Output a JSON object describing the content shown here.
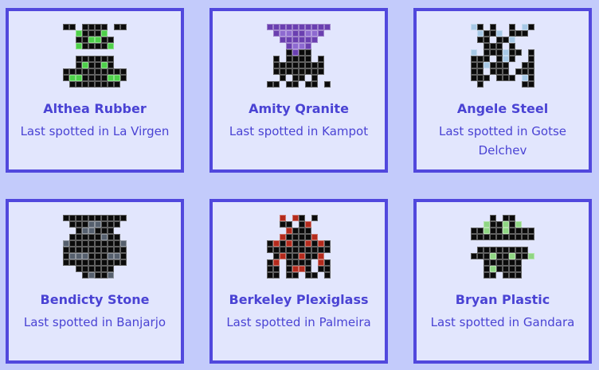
{
  "cards": [
    {
      "name": "Althea Rubber",
      "location_prefix": "Last spotted in",
      "location": "La Virgen",
      "sprite": {
        "palette": {
          "k": "#0b0b0b",
          "g": "#4ed04a",
          "w": "#ffffff"
        },
        "rows": [
          "kk.kkkk.kk",
          "..gkkkg...",
          "..kkggkk..",
          "..gkkkkg..",
          "..........",
          "..kkkkkk..",
          "..kgkkgk..",
          "kkkkkkkkkk",
          "kggkkkkggk",
          ".kkkkkkkk."
        ]
      }
    },
    {
      "name": "Amity Qranite",
      "location_prefix": "Last spotted in",
      "location": "Kampot",
      "sprite": {
        "palette": {
          "k": "#0b0b0b",
          "p": "#6a3fb0",
          "l": "#8e6ad0"
        },
        "rows": [
          "pppppppppp",
          ".pllppllp.",
          "..pppppp..",
          "...pllp...",
          "...kpkk...",
          ".k.kkkk.k.",
          ".kkkkkkkk.",
          ".kkkkkkkk.",
          "..k.kk.k..",
          "kk.kk.kk.k"
        ]
      }
    },
    {
      "name": "Angele Steel",
      "location_prefix": "Last spotted in",
      "location": "Gotse Delchev",
      "sprite": {
        "palette": {
          "k": "#0b0b0b",
          "b": "#a7c8e6",
          "w": "#ffffff"
        },
        "rows": [
          "bk.k..k.bk",
          ".bkkb.kkk.",
          ".kk.kkb...",
          "..kkk.k...",
          "b.kkkbkk.k",
          "kkk.kbk..k",
          "kkbkkk..kk",
          "kk.kkk.kkk",
          "kkk.kkk.bk",
          ".k......kk"
        ]
      }
    },
    {
      "name": "Bendicty Stone",
      "location_prefix": "Last spotted in",
      "location": "Banjarjo",
      "sprite": {
        "palette": {
          "k": "#0b0b0b",
          "s": "#56606e"
        },
        "rows": [
          "kkkkkkkkkk",
          ".kkksskkk.",
          "..ksskkk..",
          ".kkkkkskk.",
          "skkkkkkkks",
          "kkkkkkkkkk",
          "kssskkkssk",
          "kkkkkkkkkk",
          "..kkkkkk..",
          "...kskks.."
        ]
      }
    },
    {
      "name": "Berkeley Plexiglass",
      "location_prefix": "Last spotted in",
      "location": "Palmeira",
      "sprite": {
        "palette": {
          "k": "#0b0b0b",
          "r": "#b42a1c"
        },
        "rows": [
          "..r.rk.k..",
          "..kk.kr...",
          "...rkkk...",
          "..rkkkkr..",
          "krkrkkrkrk",
          "kkkkkkkkkk",
          ".krkkrkkr.",
          "kr.kkkk.rk",
          "kk.krrk.kk",
          "kk.kk.kk.k"
        ]
      }
    },
    {
      "name": "Bryan Plastic",
      "location_prefix": "Last spotted in",
      "location": "Gandara",
      "sprite": {
        "palette": {
          "k": "#0b0b0b",
          "g": "#8fd683"
        },
        "rows": [
          "...k.kk...",
          "..gkkgkg..",
          "kkgkkgkkkk",
          "kkkkkkkkkk",
          "..........",
          ".kkkkkkkk.",
          "kkkgkkgkkg",
          "..kkkkkk..",
          "..kgkkkk..",
          "..kk.kkk.."
        ]
      }
    }
  ]
}
